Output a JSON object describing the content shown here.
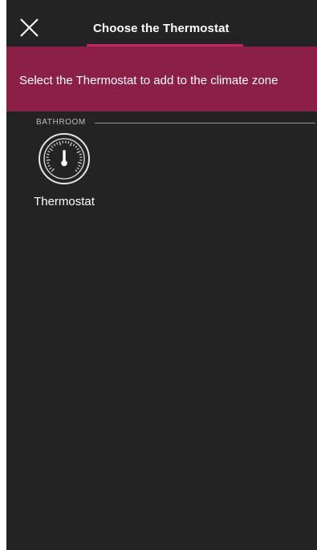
{
  "header": {
    "title": "Choose the Thermostat",
    "close_icon": "close-icon"
  },
  "banner": {
    "text": "Select the Thermostat to add to the climate zone"
  },
  "sections": [
    {
      "label": "BATHROOM",
      "devices": [
        {
          "label": "Thermostat",
          "icon": "thermostat-icon"
        }
      ]
    }
  ],
  "colors": {
    "background": "#232323",
    "banner": "#8c1f46",
    "accent": "#c0265a"
  }
}
